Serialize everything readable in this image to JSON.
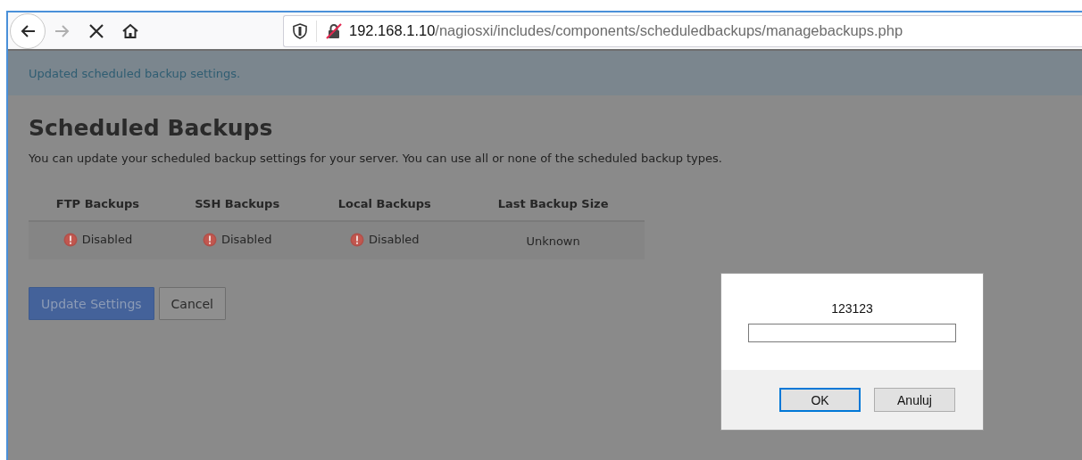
{
  "browser": {
    "nav": [
      {
        "kind": "back",
        "disabled": false
      },
      {
        "kind": "forward",
        "disabled": true
      },
      {
        "kind": "stop",
        "disabled": false
      },
      {
        "kind": "home",
        "disabled": false
      }
    ],
    "url_host": "192.168.1.10",
    "url_path": "/nagiosxi/includes/components/scheduledbackups/managebackups.php"
  },
  "alert": "Updated scheduled backup settings.",
  "page": {
    "title": "Scheduled Backups",
    "description": "You can update your scheduled backup settings for your server. You can use all or none of the scheduled backup types."
  },
  "table": {
    "columns": [
      "FTP Backups",
      "SSH Backups",
      "Local Backups",
      "Last Backup Size"
    ],
    "rows": [
      [
        {
          "text": "Disabled",
          "kind": "error"
        },
        {
          "text": "Disabled",
          "kind": "error"
        },
        {
          "text": "Disabled",
          "kind": "error"
        },
        {
          "text": "Unknown",
          "kind": "plain"
        }
      ]
    ]
  },
  "buttons": [
    {
      "label": "Update Settings",
      "kind": "primary"
    },
    {
      "label": "Cancel",
      "kind": "secondary"
    }
  ],
  "dialog": {
    "message": "123123",
    "buttons": [
      {
        "label": "OK",
        "focused": true
      },
      {
        "label": "Anuluj",
        "focused": false
      }
    ]
  }
}
